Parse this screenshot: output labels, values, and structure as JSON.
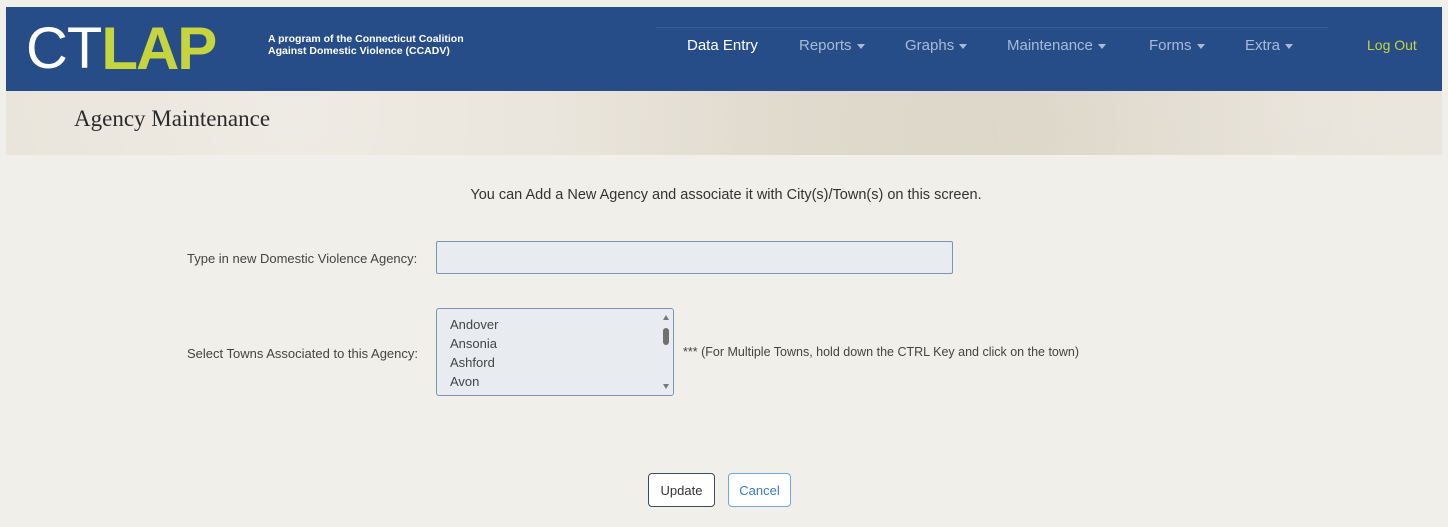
{
  "brand": {
    "logo_ct": "CT",
    "logo_lap": "LAP",
    "tagline_line1": "A program of the Connecticut Coalition",
    "tagline_line2": "Against Domestic Violence (CCADV)"
  },
  "nav": {
    "items": [
      {
        "label": "Data Entry",
        "dropdown": false
      },
      {
        "label": "Reports",
        "dropdown": true
      },
      {
        "label": "Graphs",
        "dropdown": true
      },
      {
        "label": "Maintenance",
        "dropdown": true
      },
      {
        "label": "Forms",
        "dropdown": true
      },
      {
        "label": "Extra",
        "dropdown": true
      }
    ],
    "logout": "Log Out"
  },
  "page": {
    "title": "Agency Maintenance",
    "intro": "You can Add a New Agency and associate it with City(s)/Town(s) on this screen."
  },
  "form": {
    "agency_label": "Type in new Domestic Violence Agency:",
    "agency_value": "",
    "towns_label": "Select Towns Associated to this Agency:",
    "towns": [
      "Andover",
      "Ansonia",
      "Ashford",
      "Avon"
    ],
    "towns_hint": "*** (For Multiple Towns, hold down the CTRL Key and click on the town)"
  },
  "actions": {
    "update": "Update",
    "cancel": "Cancel"
  },
  "colors": {
    "navbar": "#274d88",
    "logo_accent": "#c6d43e",
    "nav_inactive": "#a9bad6",
    "cancel_text": "#3a7cc4"
  }
}
